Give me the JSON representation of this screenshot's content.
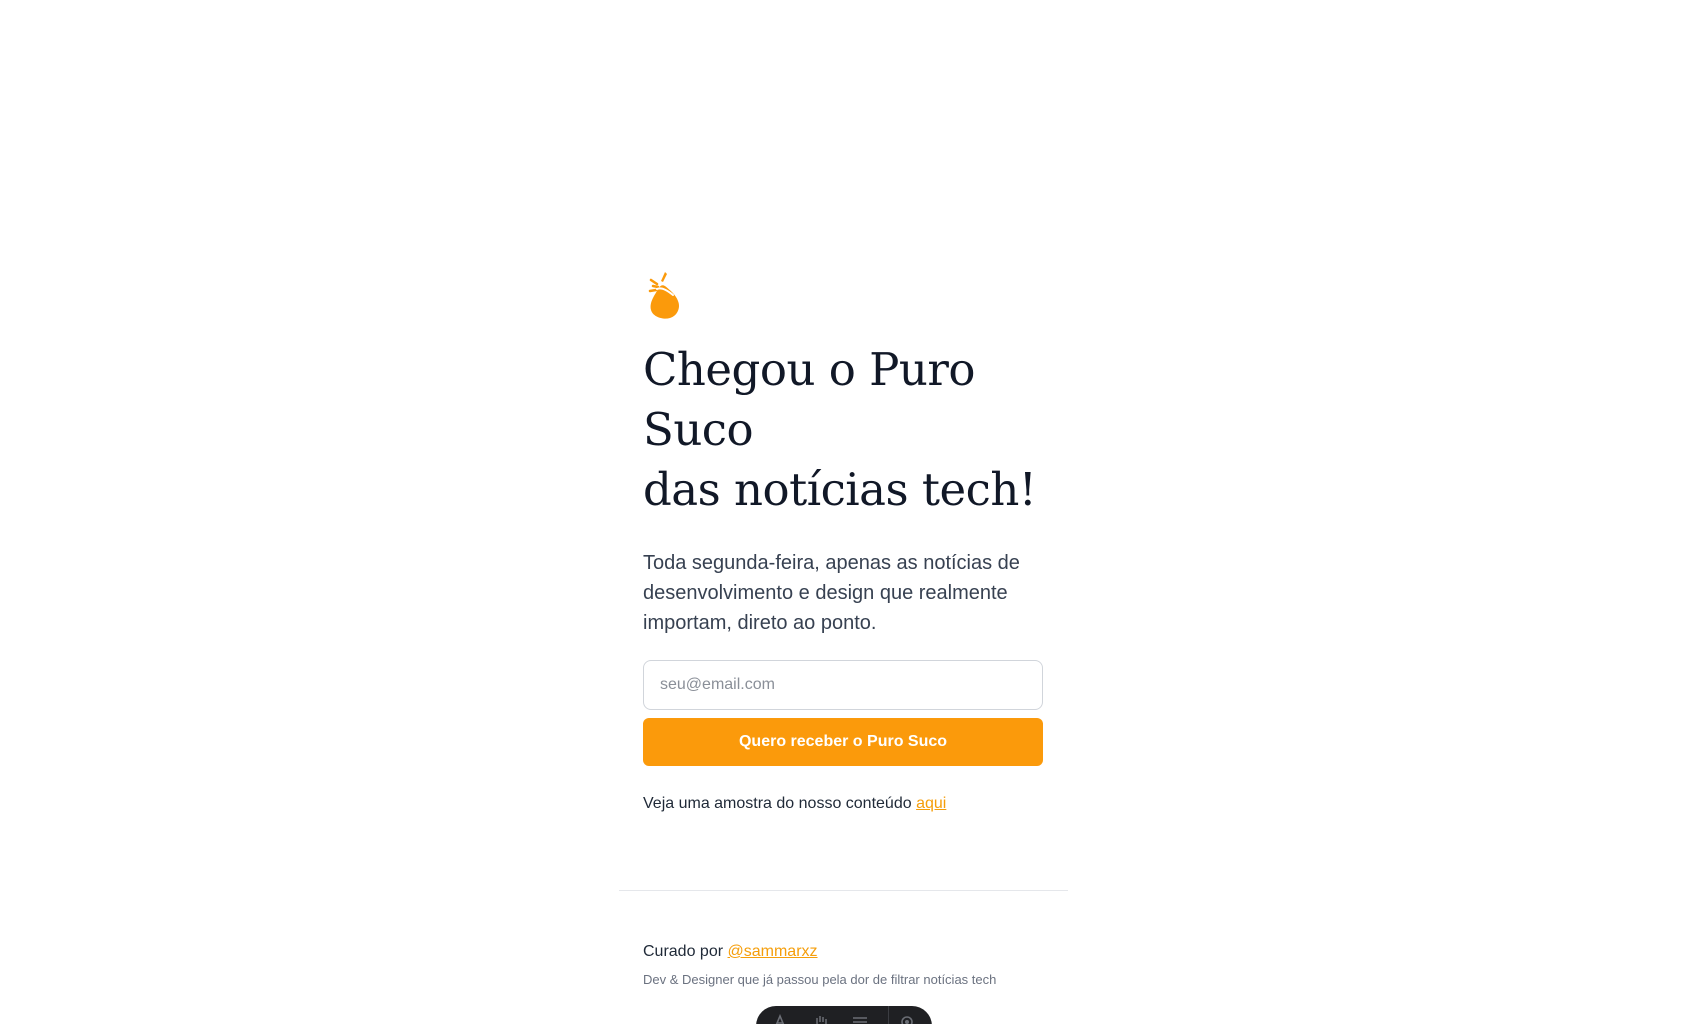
{
  "brand": {
    "logo_icon": "juice-drop-icon",
    "accent_color": "#fb9a0b"
  },
  "hero": {
    "headline_line1": "Chegou o Puro Suco",
    "headline_line2": "das notícias tech!",
    "subtitle": "Toda segunda-feira, apenas as notícias de desenvolvimento e design que realmente importam, direto ao ponto."
  },
  "signup": {
    "email_placeholder": "seu@email.com",
    "email_value": "",
    "submit_label": "Quero receber o Puro Suco"
  },
  "sample": {
    "text": "Veja uma amostra do nosso conteúdo",
    "link_label": "aqui"
  },
  "footer": {
    "curated_prefix": "Curado por",
    "curator_handle": "@sammarxz",
    "bio": "Dev & Designer que já passou pela dor de filtrar notícias tech"
  },
  "toolbar": {
    "icons": [
      "text-icon",
      "hand-icon",
      "menu-icon",
      "settings-icon"
    ]
  }
}
